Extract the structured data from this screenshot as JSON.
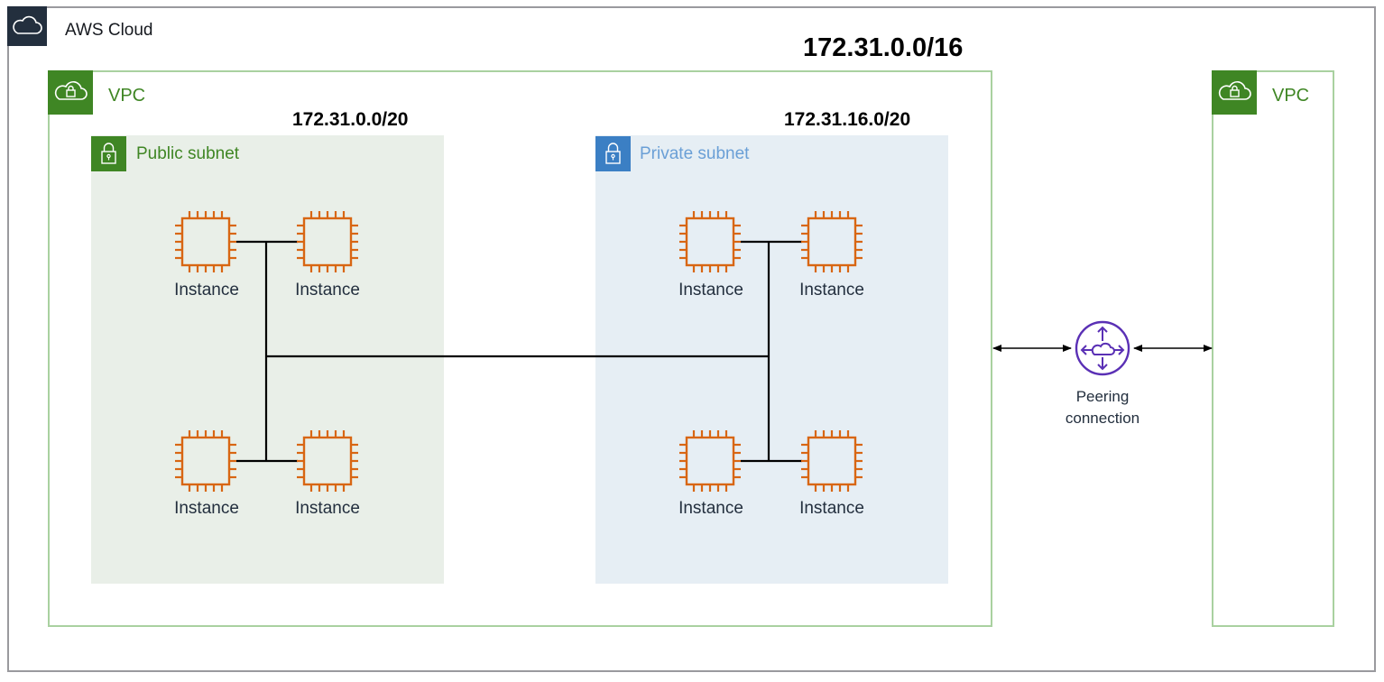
{
  "diagram": {
    "cloud": {
      "title": "AWS Cloud",
      "icon": "cloud-icon"
    },
    "vpc_main": {
      "title": "VPC",
      "icon": "vpc-cloud-lock-icon",
      "cidr": "172.31.0.0/16",
      "subnets": [
        {
          "title": "Public subnet",
          "cidr": "172.31.0.0/20",
          "icon": "lock-icon",
          "color": "#3f8624",
          "instances": [
            "Instance",
            "Instance",
            "Instance",
            "Instance"
          ]
        },
        {
          "title": "Private subnet",
          "cidr": "172.31.16.0/20",
          "icon": "lock-icon",
          "color": "#3b7fc4",
          "instances": [
            "Instance",
            "Instance",
            "Instance",
            "Instance"
          ]
        }
      ]
    },
    "peering": {
      "label_line1": "Peering",
      "label_line2": "connection",
      "icon": "peering-connection-icon",
      "color": "#5a30b5"
    },
    "vpc_peer": {
      "title": "VPC",
      "icon": "vpc-cloud-lock-icon"
    },
    "colors": {
      "aws_cloud_header": "#232f3e",
      "vpc_green": "#3f8624",
      "vpc_border": "#a9d1a0",
      "public_subnet_bg": "#e9efe8",
      "private_subnet_bg": "#e6eef4",
      "instance_orange": "#d86613",
      "peering_purple": "#5a30b5"
    }
  }
}
